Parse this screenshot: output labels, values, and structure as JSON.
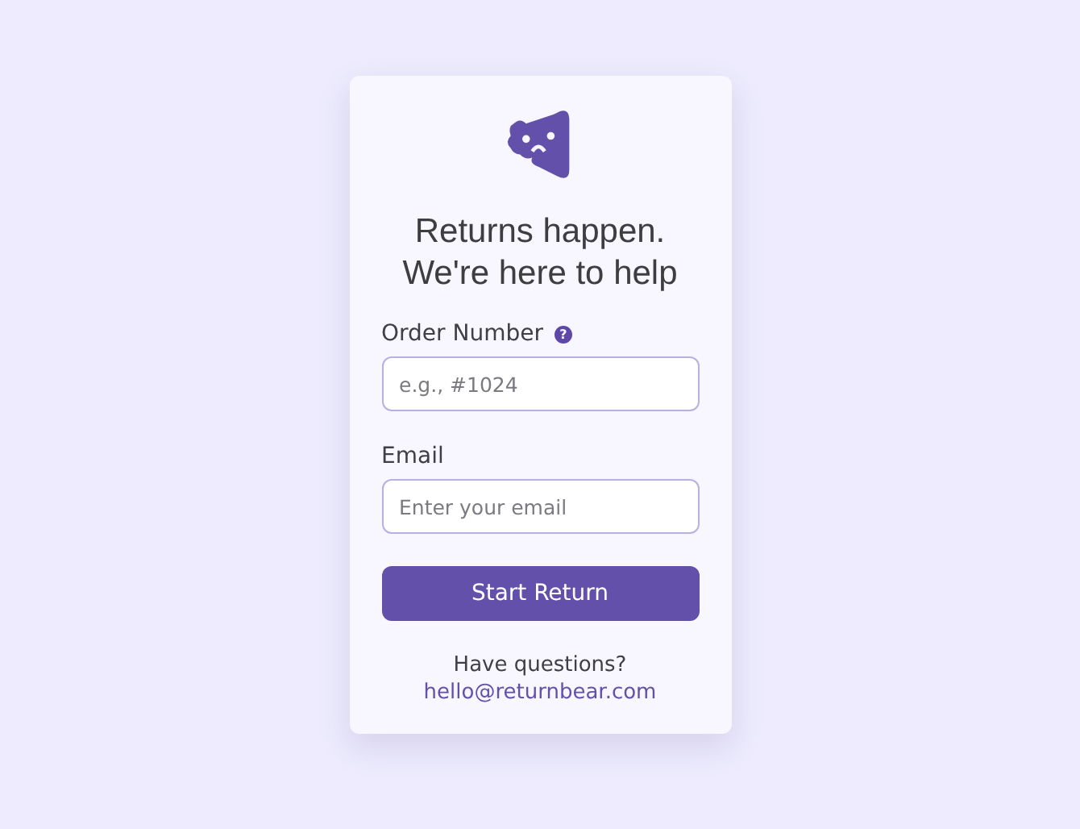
{
  "title": "Returns happen. We're here to help",
  "fields": [
    {
      "label": "Order Number",
      "placeholder": "e.g., #1024",
      "help": "?"
    },
    {
      "label": "Email",
      "placeholder": "Enter your email"
    }
  ],
  "button": "Start Return",
  "footer": {
    "text": "Have questions?",
    "link": "hello@returnbear.com"
  }
}
